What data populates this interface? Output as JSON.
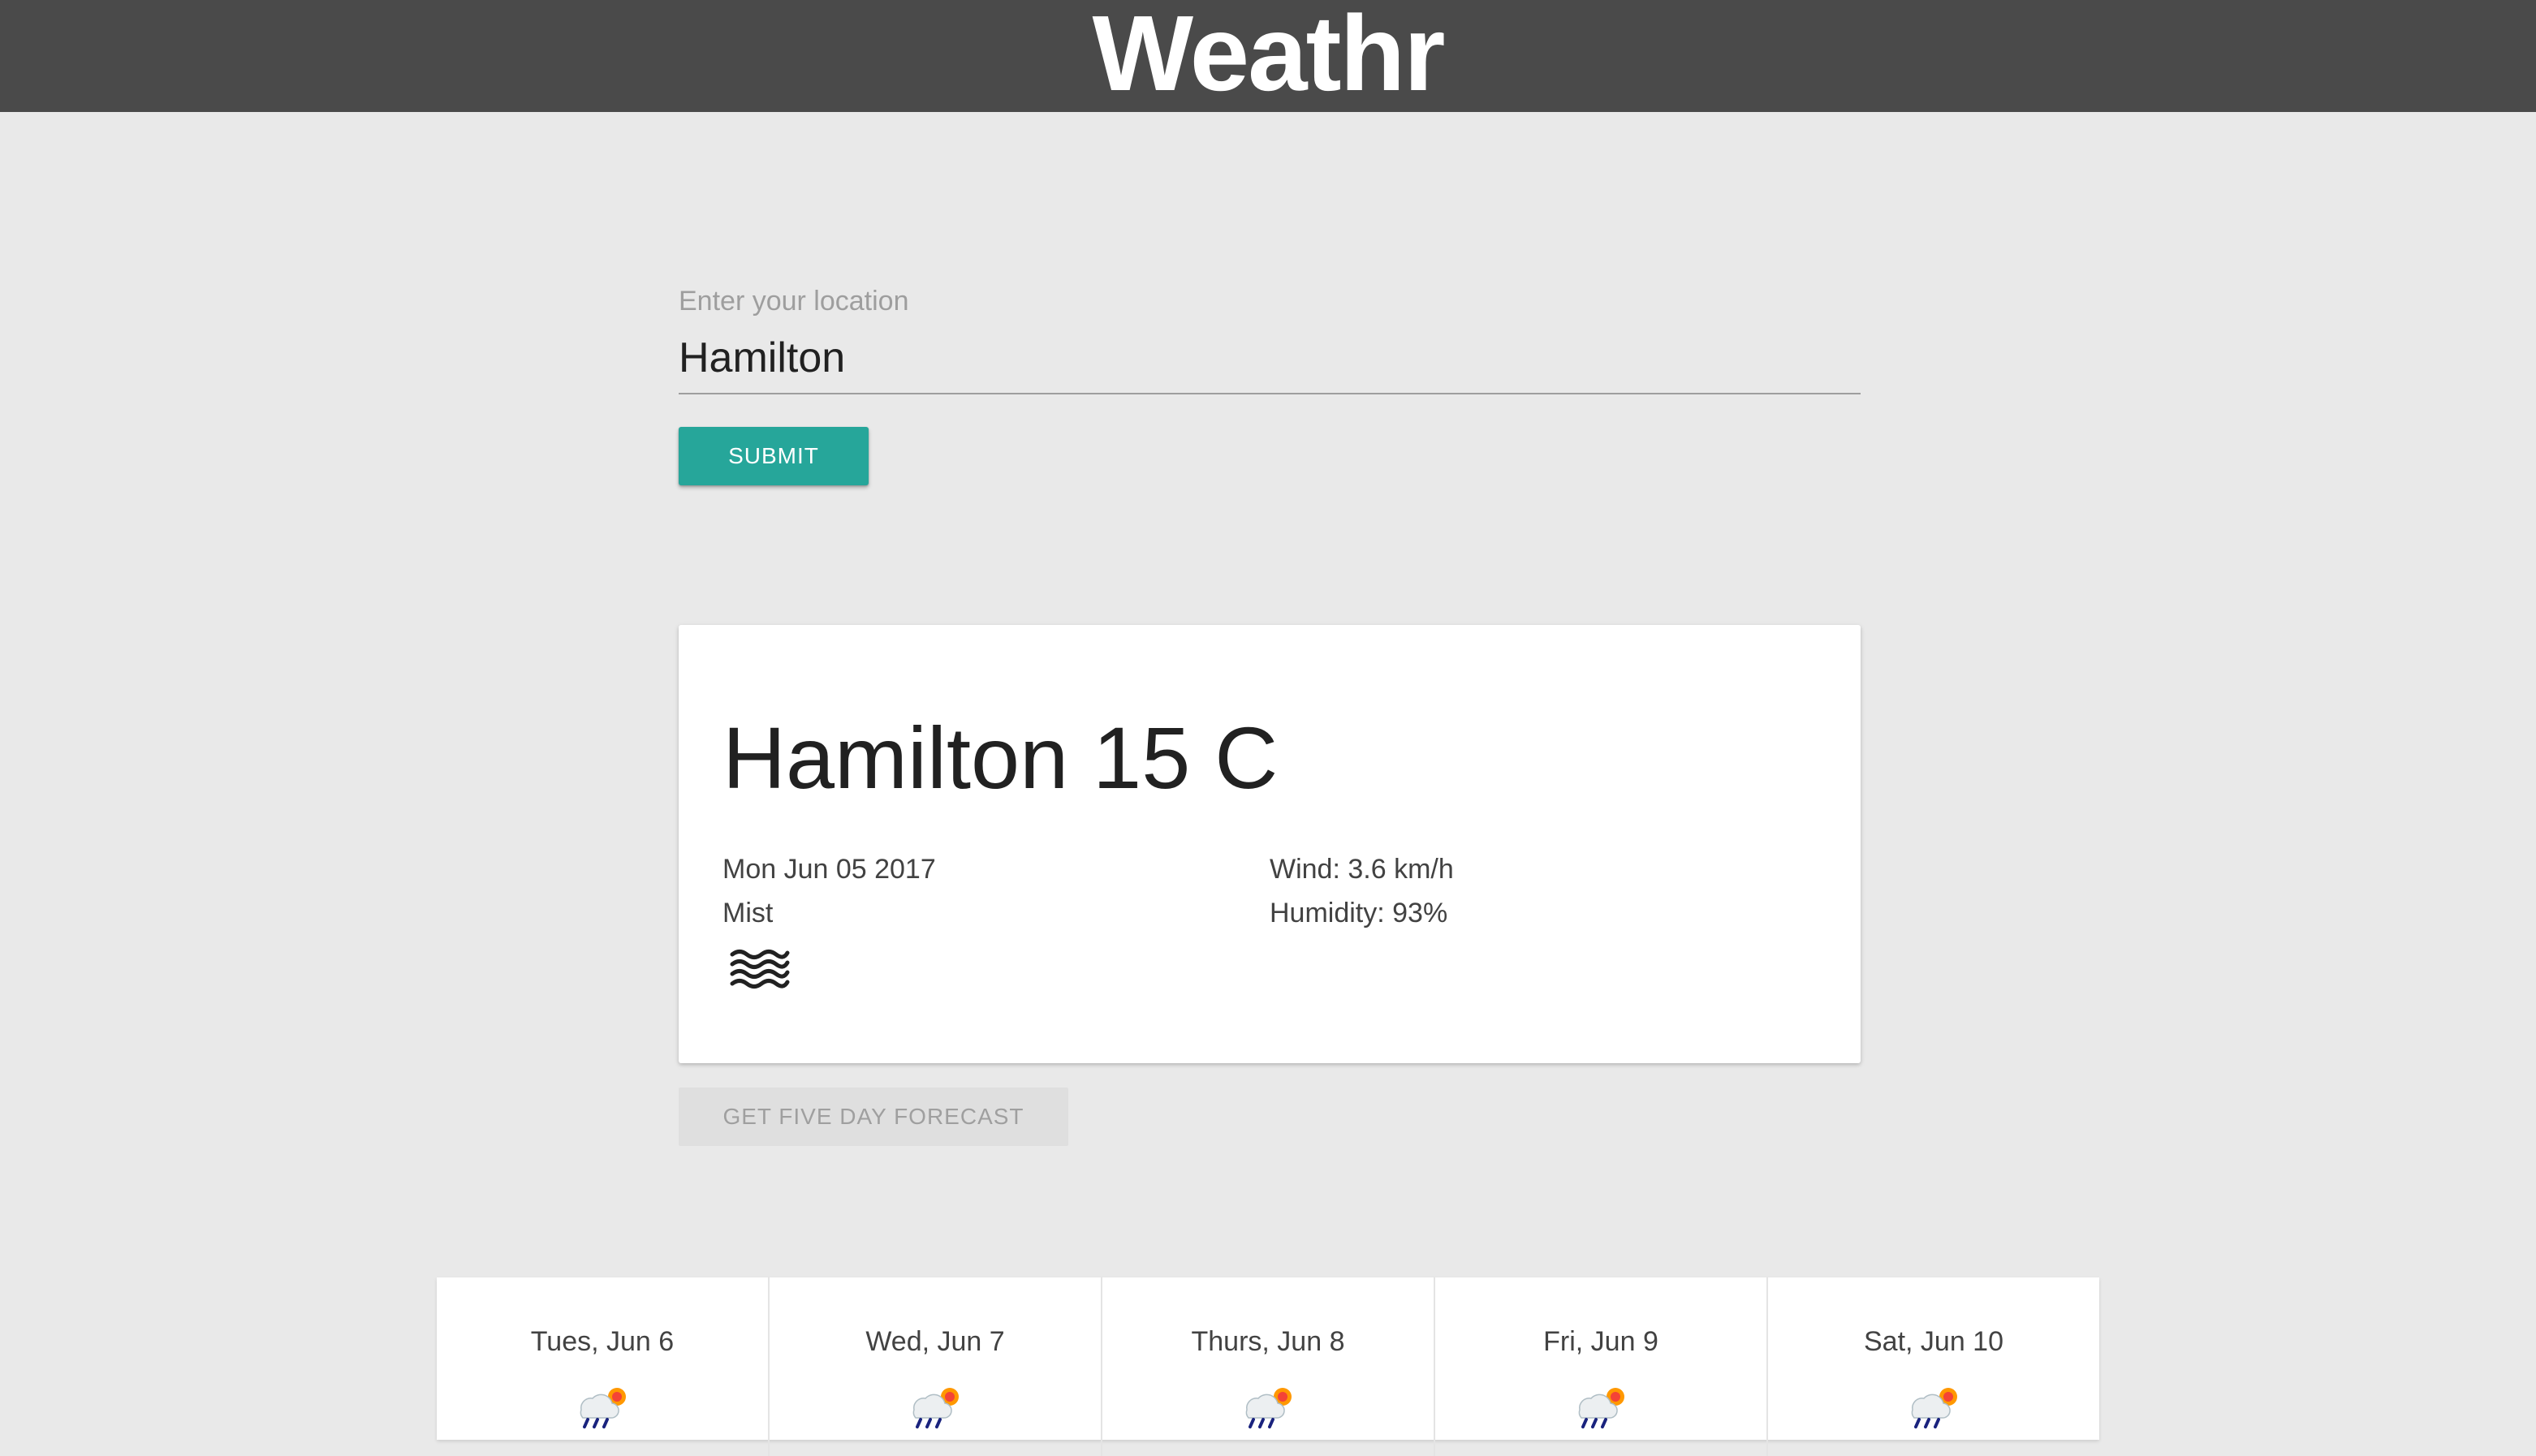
{
  "app": {
    "title": "Weathr"
  },
  "search": {
    "label": "Enter your location",
    "value": "Hamilton",
    "submit_label": "SUBMIT"
  },
  "current": {
    "heading": "Hamilton 15 C",
    "date": "Mon Jun 05 2017",
    "condition": "Mist",
    "wind": "Wind: 3.6 km/h",
    "humidity": "Humidity: 93%",
    "icon": "mist-icon"
  },
  "forecast_button": {
    "label": "GET FIVE DAY FORECAST"
  },
  "forecast": {
    "days": [
      {
        "label": "Tues, Jun 6",
        "icon": "rain-sun-icon"
      },
      {
        "label": "Wed, Jun 7",
        "icon": "rain-sun-icon"
      },
      {
        "label": "Thurs, Jun 8",
        "icon": "rain-sun-icon"
      },
      {
        "label": "Fri, Jun 9",
        "icon": "rain-sun-icon"
      },
      {
        "label": "Sat, Jun 10",
        "icon": "rain-sun-icon"
      }
    ]
  },
  "colors": {
    "app_bar": "#4a4a4a",
    "background": "#e9e9e9",
    "accent": "#26a69a",
    "disabled_button": "#dfdfdf"
  }
}
